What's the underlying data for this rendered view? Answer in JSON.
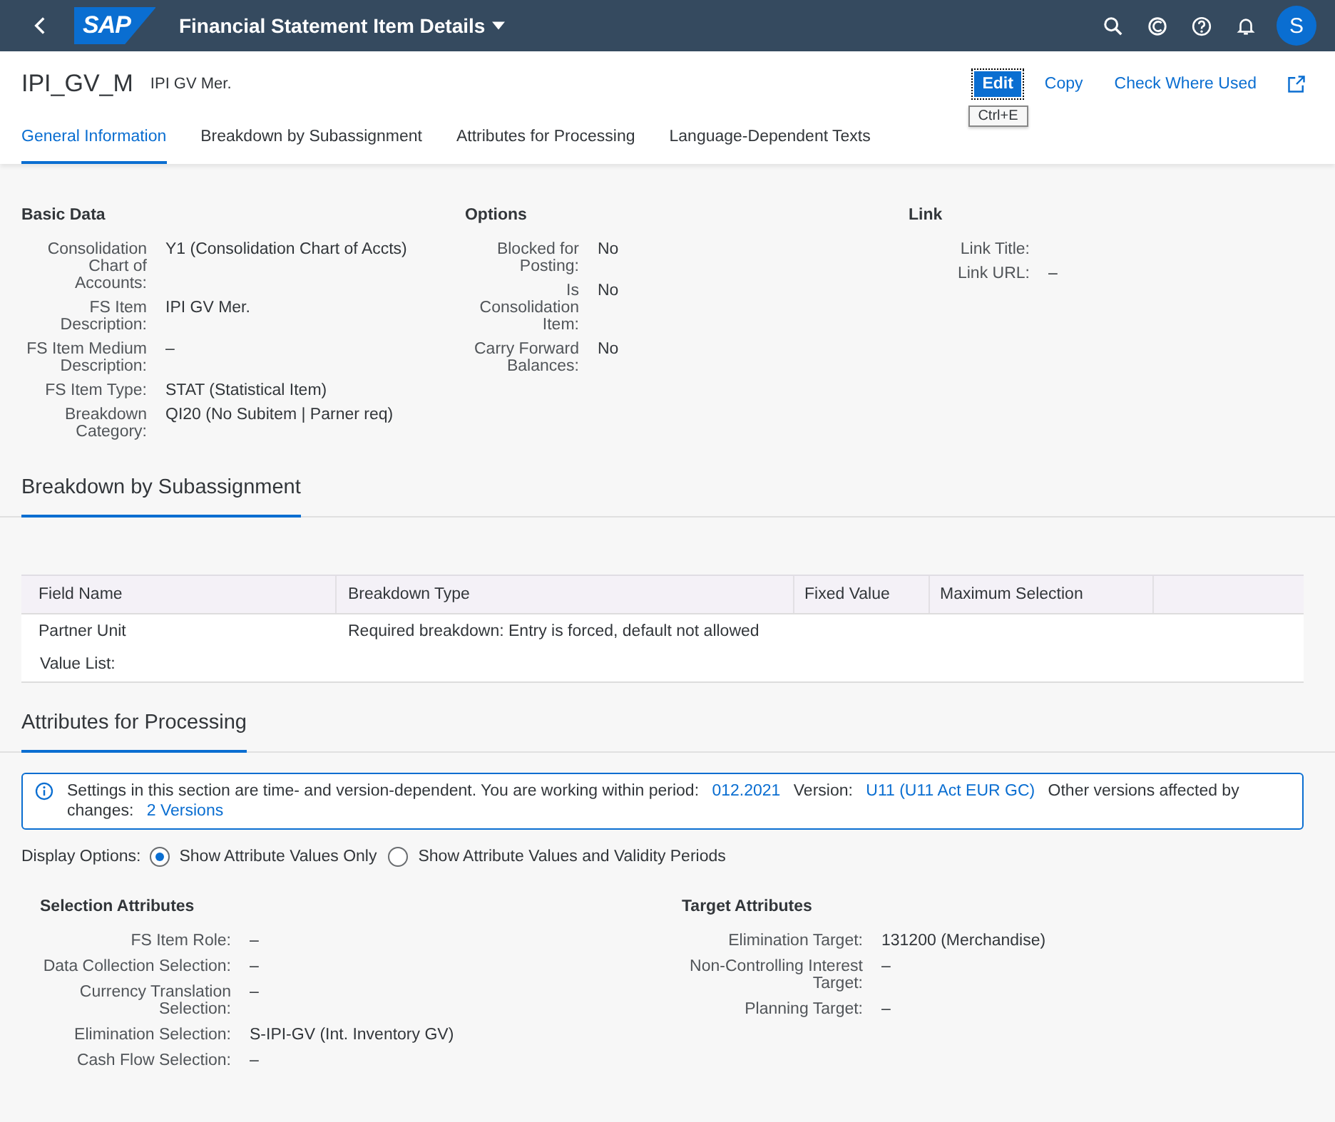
{
  "shell": {
    "logo": "SAP",
    "title": "Financial Statement Item Details",
    "avatar": "S"
  },
  "header": {
    "title": "IPI_GV_M",
    "subtitle": "IPI GV Mer.",
    "actions": [
      {
        "label": "Edit",
        "kind": "primary",
        "tooltip": "Ctrl+E"
      },
      {
        "label": "Copy",
        "kind": "link"
      },
      {
        "label": "Check Where Used",
        "kind": "link"
      }
    ]
  },
  "tabs": [
    {
      "label": "General Information",
      "selected": true
    },
    {
      "label": "Breakdown by Subassignment",
      "selected": false
    },
    {
      "label": "Attributes for Processing",
      "selected": false
    },
    {
      "label": "Language-Dependent Texts",
      "selected": false
    }
  ],
  "general": [
    {
      "title": "Basic Data",
      "fields": [
        {
          "label": "Consolidation Chart of Accounts:",
          "value": "Y1 (Consolidation Chart of Accts)"
        },
        {
          "label": "FS Item Description:",
          "value": "IPI GV Mer."
        },
        {
          "label": "FS Item Medium Description:",
          "value": "–"
        },
        {
          "label": "FS Item Type:",
          "value": "STAT (Statistical Item)"
        },
        {
          "label": "Breakdown Category:",
          "value": "QI20 (No Subitem | Parner req)"
        }
      ]
    },
    {
      "title": "Options",
      "fields": [
        {
          "label": "Blocked for Posting:",
          "value": "No"
        },
        {
          "label": "Is Consolidation Item:",
          "value": "No"
        },
        {
          "label": "Carry Forward Balances:",
          "value": "No"
        }
      ]
    },
    {
      "title": "Link",
      "fields": [
        {
          "label": "Link Title:"
        },
        {
          "label": "Link URL:",
          "value": "–"
        }
      ]
    }
  ],
  "breakdown": {
    "title": "Breakdown by Subassignment",
    "columns": [
      "Field Name",
      "Breakdown Type",
      "Fixed Value",
      "Maximum Selection"
    ],
    "rows": [
      {
        "field": "Partner Unit",
        "type": "Required breakdown: Entry is forced, default not allowed",
        "sub_label": "Value List:"
      }
    ]
  },
  "attributes": {
    "title": "Attributes for Processing",
    "message": [
      {
        "kind": "text",
        "text": "Settings in this section are time- and version-dependent. You are working within period:"
      },
      {
        "kind": "link",
        "text": "012.2021"
      },
      {
        "kind": "text",
        "text": "Version:"
      },
      {
        "kind": "link",
        "text": "U11 (U11 Act EUR GC)"
      },
      {
        "kind": "text",
        "text": "Other versions affected by changes:"
      },
      {
        "kind": "link",
        "text": "2 Versions"
      }
    ],
    "display_label": "Display Options:",
    "display_options": [
      {
        "label": "Show Attribute Values Only",
        "selected": true
      },
      {
        "label": "Show Attribute Values and Validity Periods",
        "selected": false
      }
    ],
    "groups": [
      {
        "title": "Selection Attributes",
        "fields": [
          {
            "label": "FS Item Role:",
            "value": "–"
          },
          {
            "label": "Data Collection Selection:",
            "value": "–"
          },
          {
            "label": "Currency Translation Selection:",
            "value": "–"
          },
          {
            "label": "Elimination Selection:",
            "value": "S-IPI-GV (Int. Inventory GV)"
          },
          {
            "label": "Cash Flow Selection:",
            "value": "–"
          }
        ]
      },
      {
        "title": "Target Attributes",
        "fields": [
          {
            "label": "Elimination Target:",
            "value": "131200 (Merchandise)"
          },
          {
            "label": "Non-Controlling Interest Target:",
            "value": "–"
          },
          {
            "label": "Planning Target:",
            "value": "–"
          }
        ]
      }
    ]
  }
}
